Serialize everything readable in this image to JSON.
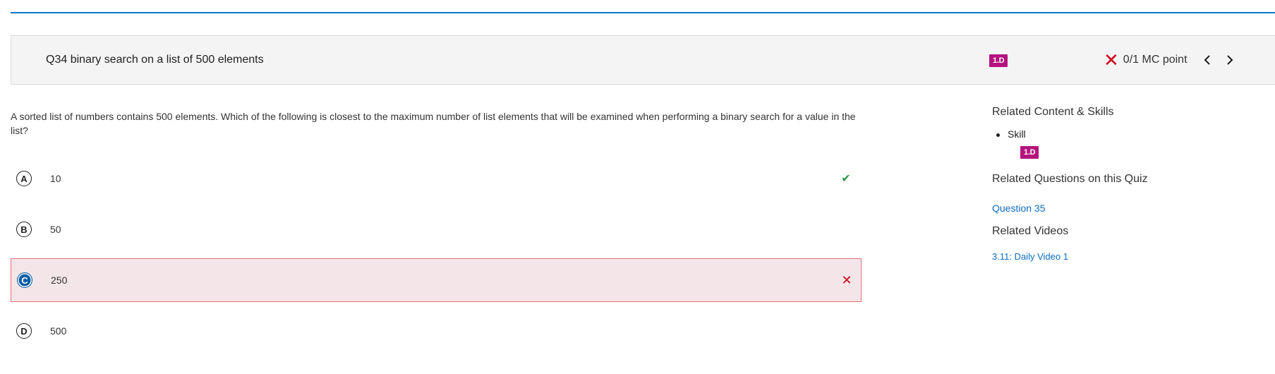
{
  "header": {
    "question_title": "Q34 binary search on a list of 500 elements",
    "skill_badge": "1.D",
    "score_icon": "x-mark-icon",
    "score_text": "0/1 MC point",
    "prev_icon": "chevron-left-icon",
    "next_icon": "chevron-right-icon"
  },
  "question": {
    "stem": "A sorted list of numbers contains 500 elements. Which of the following is closest to the maximum number of list elements that will be examined when performing a binary search for a value in the list?",
    "choices": [
      {
        "letter": "A",
        "text": "10",
        "status": "correct",
        "mark_icon": "checkmark-icon"
      },
      {
        "letter": "B",
        "text": "50",
        "status": "none"
      },
      {
        "letter": "C",
        "text": "250",
        "status": "selected-incorrect",
        "mark_icon": "x-mark-icon"
      },
      {
        "letter": "D",
        "text": "500",
        "status": "none"
      }
    ]
  },
  "sidebar": {
    "related_content_heading": "Related Content & Skills",
    "skill_label": "Skill",
    "skill_badge": "1.D",
    "related_questions_heading": "Related Questions on this Quiz",
    "related_questions": [
      "Question 35"
    ],
    "related_videos_heading": "Related Videos",
    "related_videos": [
      "3.11: Daily Video 1"
    ]
  },
  "colors": {
    "accent_line": "#0077c8",
    "badge": "#b5137e",
    "incorrect": "#d0021b",
    "correct": "#2e9a48",
    "link": "#0a6cc4",
    "selected_bg": "#f4e6e8"
  }
}
